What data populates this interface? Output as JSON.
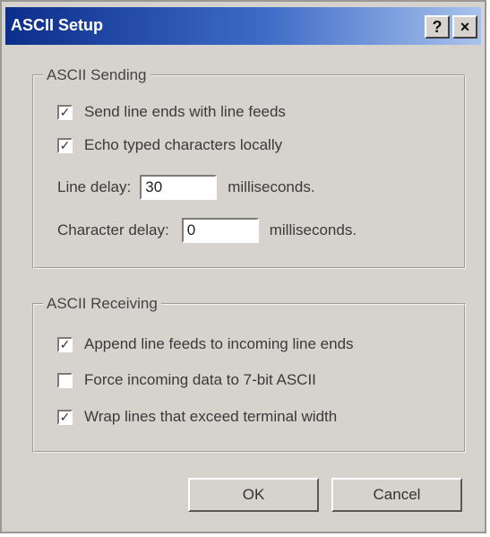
{
  "window": {
    "title": "ASCII Setup",
    "help_glyph": "?",
    "close_glyph": "×"
  },
  "sending": {
    "legend": "ASCII Sending",
    "send_line_ends": {
      "label": "Send line ends with line feeds",
      "checked": true
    },
    "echo_typed": {
      "label": "Echo typed characters locally",
      "checked": true
    },
    "line_delay": {
      "label": "Line delay:",
      "value": "30",
      "unit": "milliseconds."
    },
    "char_delay": {
      "label": "Character delay:",
      "value": "0",
      "unit": "milliseconds."
    }
  },
  "receiving": {
    "legend": "ASCII Receiving",
    "append_line_feeds": {
      "label": "Append line feeds to incoming line ends",
      "checked": true
    },
    "force_7bit": {
      "label": "Force incoming data to 7-bit ASCII",
      "checked": false
    },
    "wrap_lines": {
      "label": "Wrap lines that exceed terminal width",
      "checked": true
    }
  },
  "buttons": {
    "ok": "OK",
    "cancel": "Cancel"
  },
  "check_glyph": "✓"
}
